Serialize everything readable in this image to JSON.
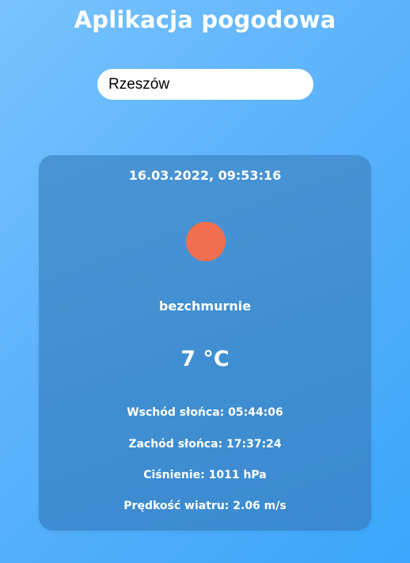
{
  "app": {
    "title": "Aplikacja pogodowa"
  },
  "search": {
    "value": "Rzeszów"
  },
  "weather": {
    "datetime": "16.03.2022, 09:53:16",
    "icon": "sun-icon",
    "icon_color": "#ef6f4f",
    "description": "bezchmurnie",
    "temperature": "7 °C",
    "sunrise": "Wschód słońca: 05:44:06",
    "sunset": "Zachód słońca: 17:37:24",
    "pressure": "Ciśnienie: 1011 hPa",
    "wind": "Prędkość wiatru: 2.06 m/s"
  },
  "colors": {
    "background_start": "#78c3ff",
    "background_end": "#3aa6fb",
    "card": "#418fd2"
  }
}
